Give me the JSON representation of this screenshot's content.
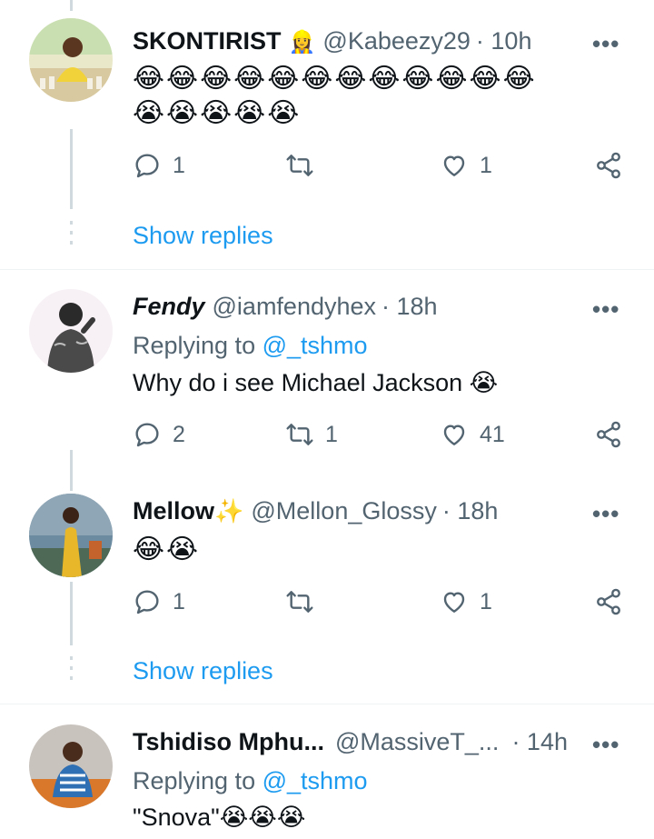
{
  "tweets": [
    {
      "name": "SKONTIRIST",
      "name_emoji": "👷‍♀️",
      "handle": "@Kabeezy29",
      "time": "· 10h",
      "text_emojis_line1": "😂😂😂😂😂😂😂😂😂😂😂😂",
      "text_emojis_line2": "😭😭😭😭😭",
      "replies": "1",
      "retweets": "",
      "likes": "1",
      "show_replies": "Show replies"
    },
    {
      "name": "Fendy",
      "handle": "@iamfendyhex",
      "time": "· 18h",
      "replying_prefix": "Replying to ",
      "replying_to": "@_tshmo",
      "text": "Why do i see Michael Jackson 😭",
      "replies": "2",
      "retweets": "1",
      "likes": "41"
    },
    {
      "name": "Mellow",
      "name_emoji": "✨",
      "handle": "@Mellon_Glossy",
      "time": "· 18h",
      "text_emojis_line1": "😂😭",
      "replies": "1",
      "retweets": "",
      "likes": "1",
      "show_replies": "Show replies"
    },
    {
      "name": "Tshidiso Mphu...",
      "handle": "@MassiveT_...",
      "time": "· 14h",
      "replying_prefix": "Replying to ",
      "replying_to": "@_tshmo",
      "text": "\"Snova\"😭😭😭"
    }
  ],
  "more_icon": "more-horizontal-icon",
  "accent_color": "#1d9bf0",
  "muted_color": "#536471"
}
